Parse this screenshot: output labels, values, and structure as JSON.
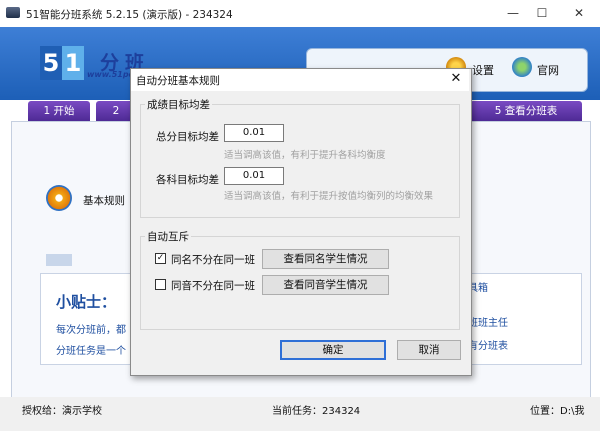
{
  "window": {
    "title": "51智能分班系统 5.2.15 (演示版) - 234324",
    "minimize": "—",
    "maximize": "☐",
    "close": "✕"
  },
  "brand": {
    "logo_digit_1": "5",
    "logo_digit_2": "1",
    "logo_text": "分班",
    "logo_url": "www.51pe"
  },
  "toolbar": {
    "settings": "设置",
    "website": "官网"
  },
  "tabs": [
    "1 开始",
    "2",
    "5 查看分班表"
  ],
  "main": {
    "basic_rules": "基本规则"
  },
  "tips": {
    "title": "小贴士：",
    "line1": "每次分班前，都",
    "line2": "分班任务是一个"
  },
  "tools": {
    "title": "具箱",
    "link1": "班班主任",
    "link2": "有分班表"
  },
  "status": {
    "licensed_to": "授权给：演示学校",
    "current_task": "当前任务：234324",
    "location": "位置：D:\\我"
  },
  "dialog": {
    "title": "自动分班基本规则",
    "close": "✕",
    "group1_label": "成绩目标均差",
    "total_label": "总分目标均差",
    "total_value": "0.01",
    "total_hint": "适当调高该值，有利于提升各科均衡度",
    "subject_label": "各科目标均差",
    "subject_value": "0.01",
    "subject_hint": "适当调高该值，有利于提升按值均衡列的均衡效果",
    "group2_label": "自动互斥",
    "same_name_label": "同名不分在同一班",
    "same_name_checked": true,
    "same_name_button": "查看同名学生情况",
    "same_sound_label": "同音不分在同一班",
    "same_sound_checked": false,
    "same_sound_button": "查看同音学生情况",
    "ok": "确定",
    "cancel": "取消"
  }
}
